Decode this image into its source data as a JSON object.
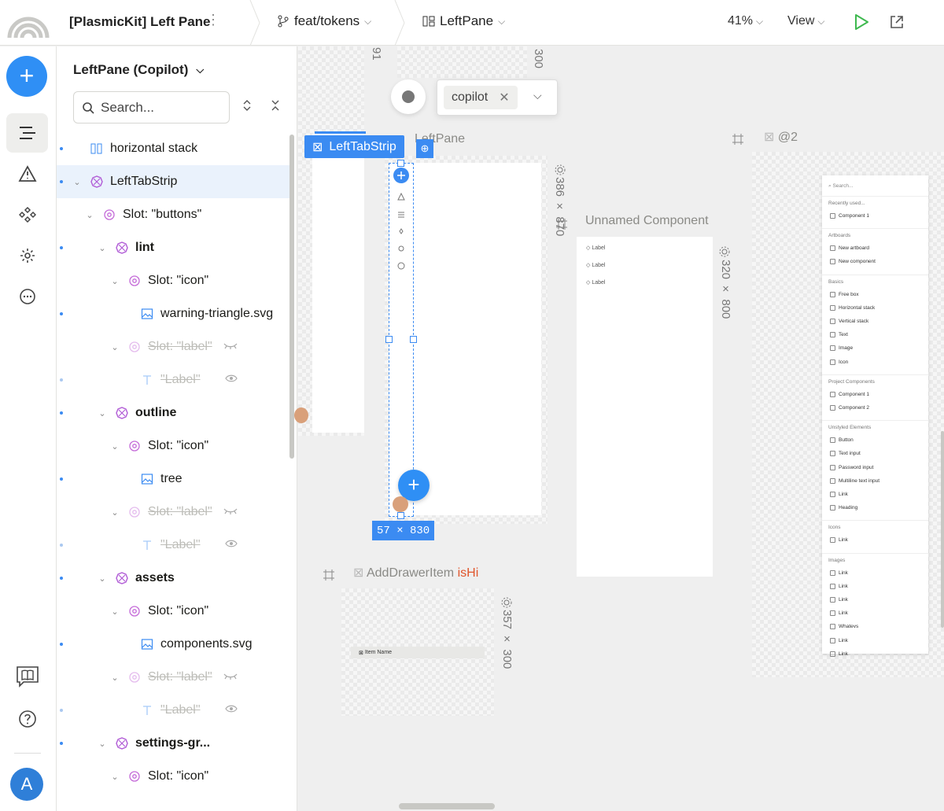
{
  "topbar": {
    "project_title": "[PlasmicKit] Left Pane",
    "branch": "feat/tokens",
    "arena": "LeftPane",
    "zoom": "41%",
    "view_label": "View"
  },
  "panel": {
    "title": "LeftPane (Copilot)",
    "search_placeholder": "Search...",
    "tree": [
      {
        "label": "horizontal stack",
        "depth": 0,
        "icon": "hstack-icon",
        "dot": "blue"
      },
      {
        "label": "LeftTabStrip",
        "depth": 0,
        "icon": "component-icon",
        "dot": "blue",
        "selected": true,
        "chevron": true
      },
      {
        "label": "Slot: \"buttons\"",
        "depth": 1,
        "icon": "slot-icon",
        "chevron": true
      },
      {
        "label": "lint",
        "depth": 2,
        "icon": "component-icon",
        "dot": "blue",
        "chevron": true,
        "bold": true
      },
      {
        "label": "Slot: \"icon\"",
        "depth": 3,
        "icon": "slot-icon",
        "chevron": true
      },
      {
        "label": "warning-triangle.svg",
        "depth": 4,
        "icon": "image-icon",
        "dot": "blue"
      },
      {
        "label": "Slot: \"label\"",
        "depth": 3,
        "icon": "slot-icon",
        "chevron": true,
        "hidden": true,
        "eye": "eye-closed-icon"
      },
      {
        "label": "\"Label\"",
        "depth": 4,
        "icon": "text-icon",
        "dot": "light",
        "hidden": true,
        "eye": "eye-icon"
      },
      {
        "label": "outline",
        "depth": 2,
        "icon": "component-icon",
        "dot": "blue",
        "chevron": true,
        "bold": true
      },
      {
        "label": "Slot: \"icon\"",
        "depth": 3,
        "icon": "slot-icon",
        "chevron": true
      },
      {
        "label": "tree",
        "depth": 4,
        "icon": "image-icon",
        "dot": "blue"
      },
      {
        "label": "Slot: \"label\"",
        "depth": 3,
        "icon": "slot-icon",
        "chevron": true,
        "hidden": true,
        "eye": "eye-closed-icon"
      },
      {
        "label": "\"Label\"",
        "depth": 4,
        "icon": "text-icon",
        "dot": "light",
        "hidden": true,
        "eye": "eye-icon"
      },
      {
        "label": "assets",
        "depth": 2,
        "icon": "component-icon",
        "dot": "blue",
        "chevron": true,
        "bold": true
      },
      {
        "label": "Slot: \"icon\"",
        "depth": 3,
        "icon": "slot-icon",
        "chevron": true
      },
      {
        "label": "components.svg",
        "depth": 4,
        "icon": "image-icon",
        "dot": "blue"
      },
      {
        "label": "Slot: \"label\"",
        "depth": 3,
        "icon": "slot-icon",
        "chevron": true,
        "hidden": true,
        "eye": "eye-closed-icon"
      },
      {
        "label": "\"Label\"",
        "depth": 4,
        "icon": "text-icon",
        "dot": "light",
        "hidden": true,
        "eye": "eye-icon"
      },
      {
        "label": "settings-gr...",
        "depth": 2,
        "icon": "component-icon",
        "dot": "blue",
        "chevron": true,
        "bold": true
      },
      {
        "label": "Slot: \"icon\"",
        "depth": 3,
        "icon": "slot-icon",
        "chevron": true
      }
    ]
  },
  "canvas": {
    "selected_label": "LeftTabStrip",
    "copilot_chip": "copilot",
    "leftpane_label": "LeftPane",
    "leftpane_dims": "386 × 870",
    "measure": "57 × 830",
    "top_dims": "300",
    "top_left_dims": "91",
    "unnamed_label": "Unnamed Component",
    "unnamed_dims": "320 × 800",
    "unnamed_items": [
      "Label",
      "Label",
      "Label"
    ],
    "at2_label": "@2",
    "drawer_label": "AddDrawerItem",
    "drawer_variant": "isHi",
    "drawer_dims": "357 × 300",
    "drawer_item": "Item Name",
    "mini_panel": {
      "search": "Search...",
      "sections": [
        {
          "title": "Recently used...",
          "items": [
            "Component 1"
          ]
        },
        {
          "title": "Artboards",
          "items": [
            "New artboard",
            "New component"
          ]
        },
        {
          "title": "Basics",
          "items": [
            "Free box",
            "Horizontal stack",
            "Vertical stack",
            "Text",
            "Image",
            "Icon"
          ]
        },
        {
          "title": "Project Components",
          "items": [
            "Component 1",
            "Component 2"
          ]
        },
        {
          "title": "Unstyled Elements",
          "items": [
            "Button",
            "Text input",
            "Password input",
            "Multiline text input",
            "Link",
            "Heading"
          ]
        },
        {
          "title": "Icons",
          "items": [
            "Link"
          ]
        },
        {
          "title": "Images",
          "items": [
            "Link",
            "Link",
            "Link",
            "Link",
            "Whatevs",
            "Link",
            "Link"
          ]
        }
      ]
    }
  },
  "rail": {
    "avatar_letter": "A"
  },
  "colors": {
    "accent": "#3b8bf2",
    "component": "#b05ad6",
    "slot": "#c46ad8",
    "play": "#3fb950",
    "variant": "#e0552b"
  }
}
